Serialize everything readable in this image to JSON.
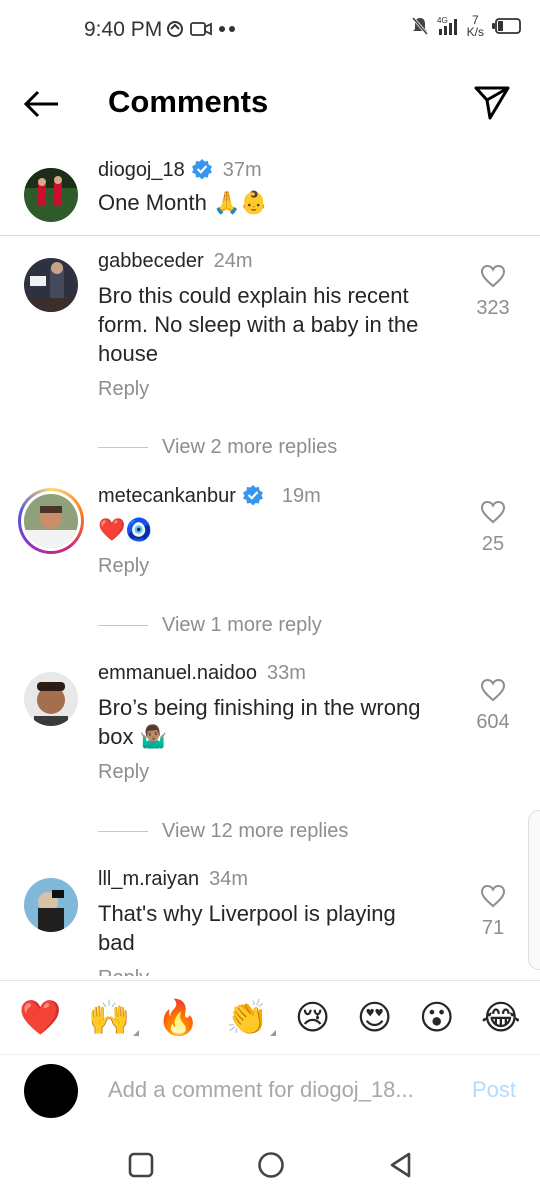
{
  "status_bar": {
    "time": "9:40 PM",
    "net_speed_top": "7",
    "net_speed_bottom": "K/s",
    "network": "4G"
  },
  "header": {
    "title": "Comments"
  },
  "caption": {
    "username": "diogoj_18",
    "verified": true,
    "time": "37m",
    "text": "One Month 🙏👶"
  },
  "comments": [
    {
      "username": "gabbeceder",
      "verified": false,
      "time": "24m",
      "text": "Bro this could explain his recent form. No sleep with a baby in the house",
      "reply_label": "Reply",
      "likes": "323",
      "view_replies": "View 2 more replies"
    },
    {
      "username": "metecankanbur",
      "verified": true,
      "time": "19m",
      "text": "❤️🧿",
      "reply_label": "Reply",
      "likes": "25",
      "view_replies": "View 1 more reply"
    },
    {
      "username": "emmanuel.naidoo",
      "verified": false,
      "time": "33m",
      "text": "Bro’s being finishing in the wrong box 🤷🏽‍♂️",
      "reply_label": "Reply",
      "likes": "604",
      "view_replies": "View 12 more replies"
    },
    {
      "username": "lll_m.raiyan",
      "verified": false,
      "time": "34m",
      "text": "That's why Liverpool is playing bad",
      "reply_label": "Reply",
      "likes": "71"
    }
  ],
  "emoji_bar": [
    "❤️",
    "🙌",
    "🔥",
    "👏",
    "😢",
    "😍",
    "😮",
    "😂"
  ],
  "composer": {
    "placeholder": "Add a comment for diogoj_18...",
    "post_label": "Post"
  },
  "colors": {
    "verified": "#3797f0",
    "post_disabled": "#b3dbff",
    "secondary_text": "#8e8e8e"
  }
}
